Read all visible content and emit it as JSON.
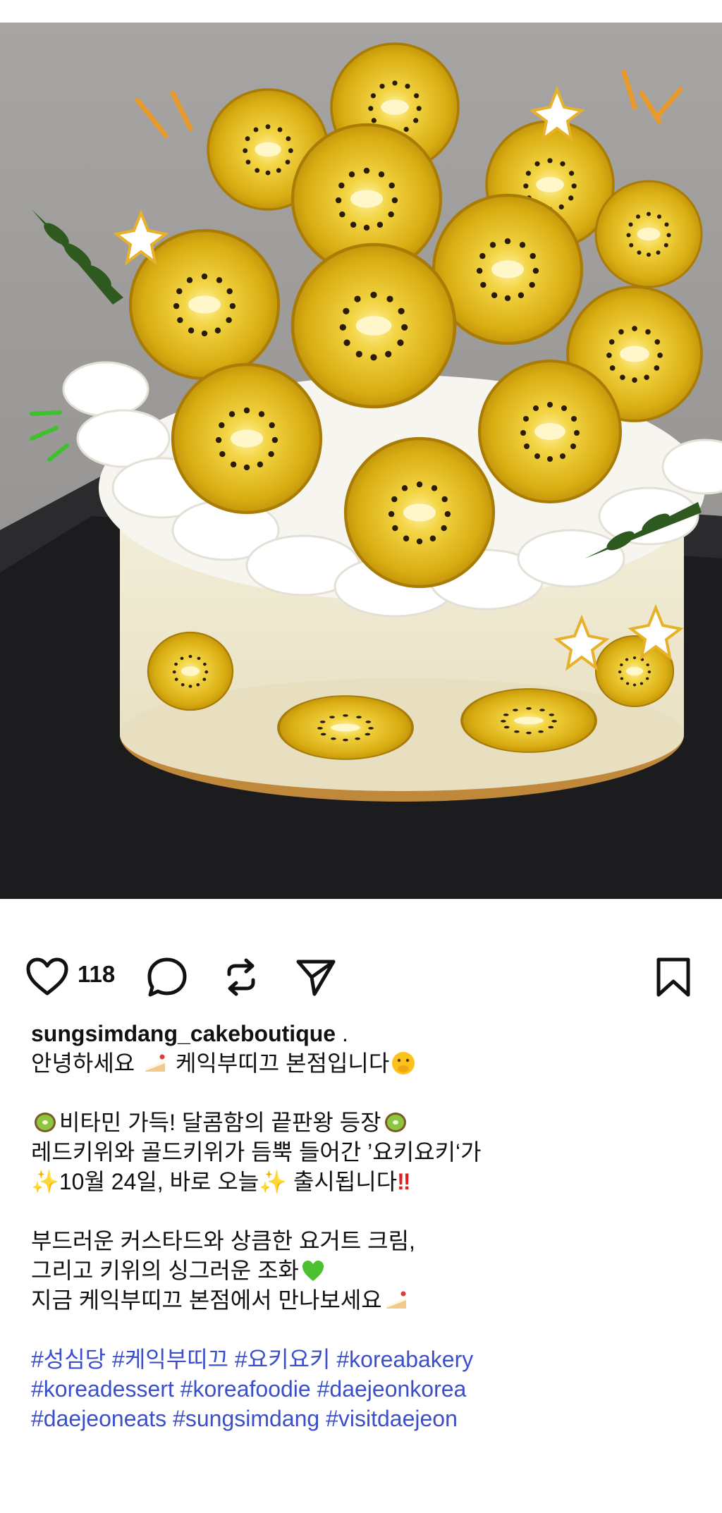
{
  "post": {
    "like_count": "118",
    "username": "sungsimdang_cakeboutique",
    "username_suffix": " .",
    "caption": {
      "line1": {
        "a": "안녕하세요 ",
        "b": " 케익부띠끄 본점입니다"
      },
      "line2": {
        "a": "비타민 가득! 달콤함의 끝판왕 등장"
      },
      "line3": "레드키위와 골드키위가 듬뿍 들어간 ’요키요키‘가",
      "line4": {
        "a": "10월 24일, 바로 오늘",
        "b": " 출시됩니다"
      },
      "line5": "부드러운 커스타드와 상큼한 요거트 크림,",
      "line6": "그리고 키위의 싱그러운 조화",
      "line7": "지금 케익부띠끄 본점에서 만나보세요"
    },
    "hashtags": [
      [
        "#성심당",
        "#케익부띠끄",
        "#요키요키",
        "#koreabakery"
      ],
      [
        "#koreadessert",
        "#koreafoodie",
        "#daejeonkorea"
      ],
      [
        "#daejeoneats",
        "#sungsimdang",
        "#visitdaejeon"
      ]
    ]
  },
  "icons": {
    "like": "heart-icon",
    "comment": "comment-bubble-icon",
    "repost": "repost-icon",
    "share": "send-icon",
    "save": "bookmark-icon"
  },
  "colors": {
    "hashtag": "#3b4fc9",
    "kiwi": "#e2b820",
    "cream": "#f6f3ec"
  }
}
